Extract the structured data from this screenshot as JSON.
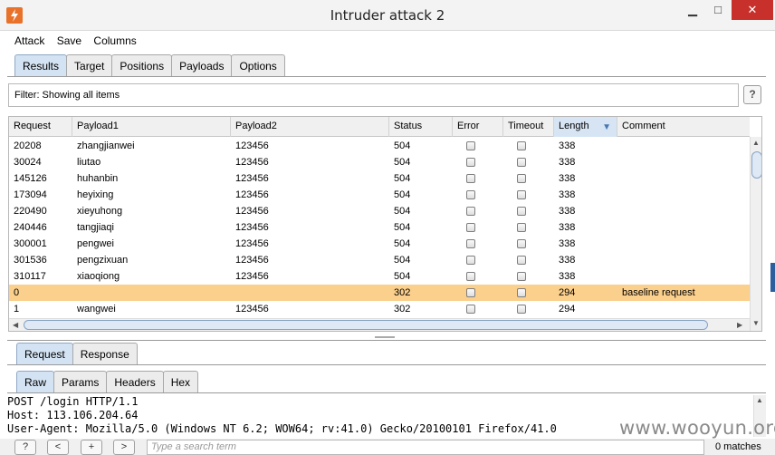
{
  "window": {
    "title": "Intruder attack 2",
    "minimize": "▁",
    "maximize": "□",
    "close": "✕"
  },
  "menu": [
    "Attack",
    "Save",
    "Columns"
  ],
  "main_tabs": [
    "Results",
    "Target",
    "Positions",
    "Payloads",
    "Options"
  ],
  "filter": {
    "text": "Filter: Showing all items",
    "help": "?"
  },
  "table": {
    "columns": [
      "Request",
      "Payload1",
      "Payload2",
      "Status",
      "Error",
      "Timeout",
      "Length",
      "Comment"
    ],
    "sort_icon": "▼",
    "rows": [
      {
        "request": "20208",
        "payload1": "zhangjianwei",
        "payload2": "123456",
        "status": "504",
        "error": false,
        "timeout": false,
        "length": "338",
        "comment": ""
      },
      {
        "request": "30024",
        "payload1": "liutao",
        "payload2": "123456",
        "status": "504",
        "error": false,
        "timeout": false,
        "length": "338",
        "comment": ""
      },
      {
        "request": "145126",
        "payload1": "huhanbin",
        "payload2": "123456",
        "status": "504",
        "error": false,
        "timeout": false,
        "length": "338",
        "comment": ""
      },
      {
        "request": "173094",
        "payload1": "heyixing",
        "payload2": "123456",
        "status": "504",
        "error": false,
        "timeout": false,
        "length": "338",
        "comment": ""
      },
      {
        "request": "220490",
        "payload1": "xieyuhong",
        "payload2": "123456",
        "status": "504",
        "error": false,
        "timeout": false,
        "length": "338",
        "comment": ""
      },
      {
        "request": "240446",
        "payload1": "tangjiaqi",
        "payload2": "123456",
        "status": "504",
        "error": false,
        "timeout": false,
        "length": "338",
        "comment": ""
      },
      {
        "request": "300001",
        "payload1": "pengwei",
        "payload2": "123456",
        "status": "504",
        "error": false,
        "timeout": false,
        "length": "338",
        "comment": ""
      },
      {
        "request": "301536",
        "payload1": "pengzixuan",
        "payload2": "123456",
        "status": "504",
        "error": false,
        "timeout": false,
        "length": "338",
        "comment": ""
      },
      {
        "request": "310117",
        "payload1": "xiaoqiong",
        "payload2": "123456",
        "status": "504",
        "error": false,
        "timeout": false,
        "length": "338",
        "comment": ""
      },
      {
        "request": "0",
        "payload1": "",
        "payload2": "",
        "status": "302",
        "error": false,
        "timeout": false,
        "length": "294",
        "comment": "baseline request",
        "highlighted": true
      },
      {
        "request": "1",
        "payload1": "wangwei",
        "payload2": "123456",
        "status": "302",
        "error": false,
        "timeout": false,
        "length": "294",
        "comment": ""
      }
    ]
  },
  "request_tabs": [
    "Request",
    "Response"
  ],
  "view_tabs": [
    "Raw",
    "Params",
    "Headers",
    "Hex"
  ],
  "raw_lines": [
    "POST /login HTTP/1.1",
    "Host: 113.106.204.64",
    "User-Agent: Mozilla/5.0 (Windows NT 6.2; WOW64; rv:41.0) Gecko/20100101 Firefox/41.0"
  ],
  "watermark": "www.wooyun.org",
  "search": {
    "help": "?",
    "prev": "<",
    "add": "+",
    "next": ">",
    "placeholder": "Type a search term",
    "matches": "0 matches"
  },
  "colors": {
    "highlight_row": "#fbcf8c",
    "close_button": "#c7302b",
    "active_tab": "#d4e3f3"
  }
}
